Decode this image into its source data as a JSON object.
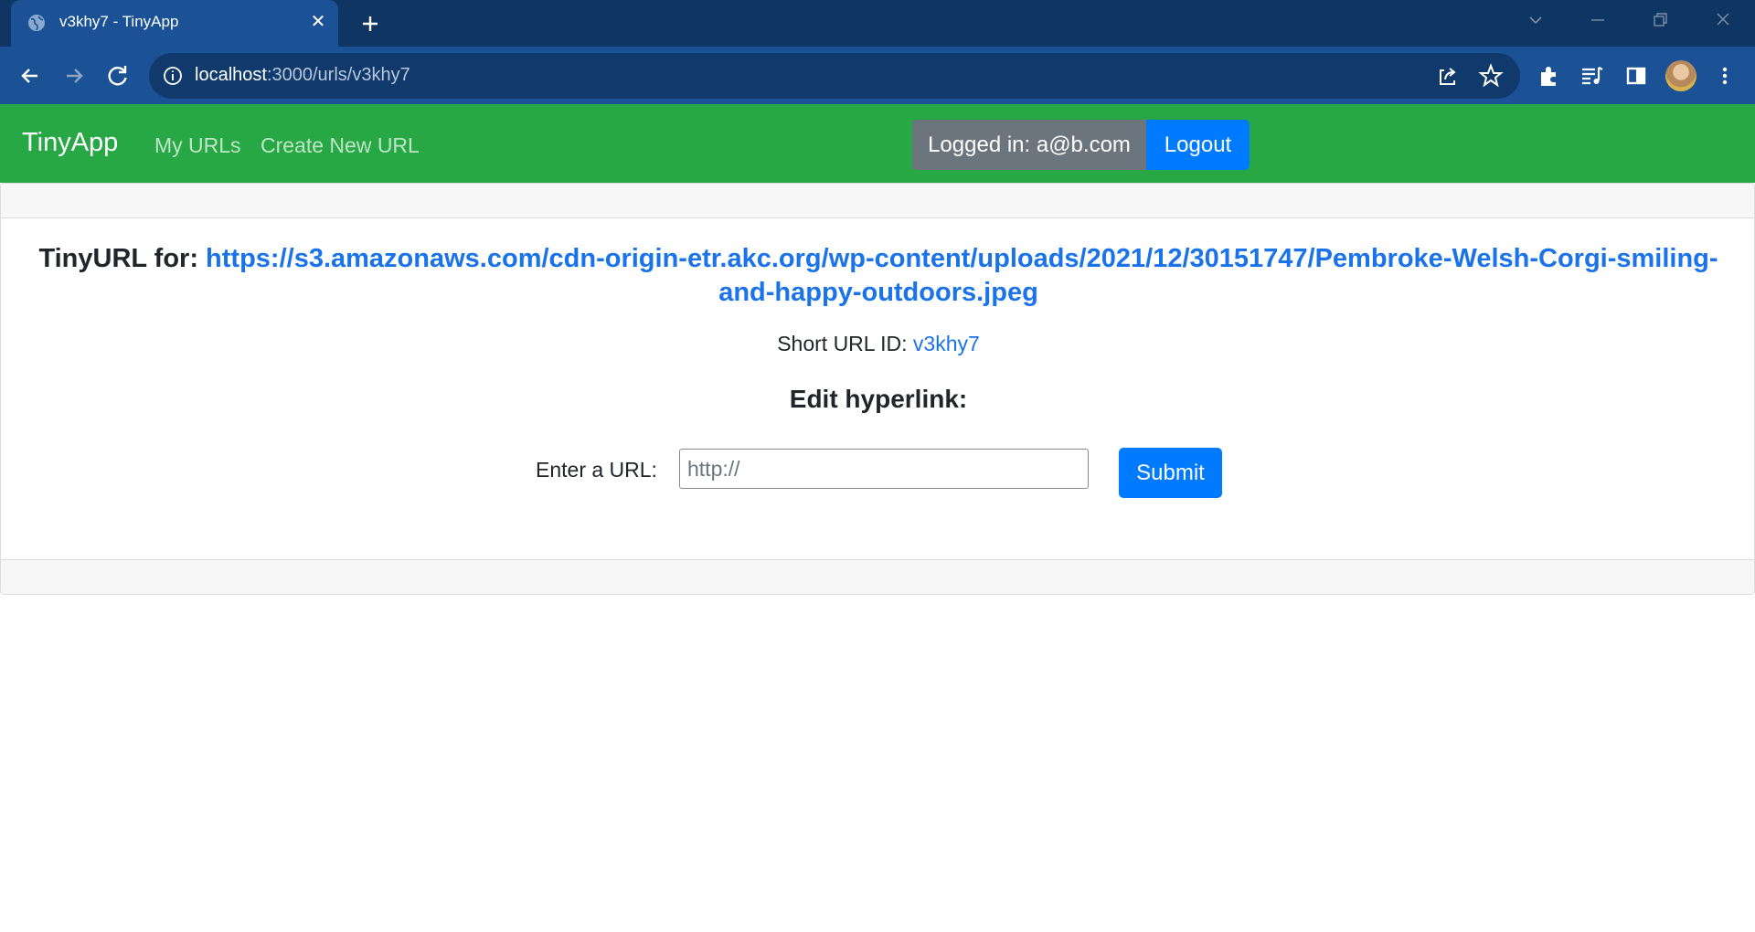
{
  "browser": {
    "tab_title": "v3khy7 - TinyApp",
    "url_host": "localhost",
    "url_rest": ":3000/urls/v3khy7",
    "icons": [
      "globe-icon",
      "close-icon",
      "plus-icon",
      "chevron-down-icon",
      "minimize-icon",
      "restore-icon",
      "window-close-icon",
      "back-arrow-icon",
      "forward-arrow-icon",
      "reload-icon",
      "info-icon",
      "share-icon",
      "star-icon",
      "puzzle-icon",
      "media-icon",
      "sidepanel-icon",
      "kebab-menu-icon"
    ]
  },
  "navbar": {
    "brand": "TinyApp",
    "links": [
      "My URLs",
      "Create New URL"
    ],
    "logged_in": "Logged in: a@b.com",
    "logout": "Logout",
    "color": "#28a745"
  },
  "main": {
    "title_label": "TinyURL for:",
    "long_url": "https://s3.amazonaws.com/cdn-origin-etr.akc.org/wp-content/uploads/2021/12/30151747/Pembroke-Welsh-Corgi-smiling-and-happy-outdoors.jpeg",
    "short_id_label": "Short URL ID:",
    "short_id": "v3khy7",
    "edit_heading": "Edit hyperlink:",
    "url_label": "Enter a URL:",
    "url_placeholder": "http://",
    "submit": "Submit",
    "link_color": "#1a73e8",
    "button_color": "#007bff"
  }
}
